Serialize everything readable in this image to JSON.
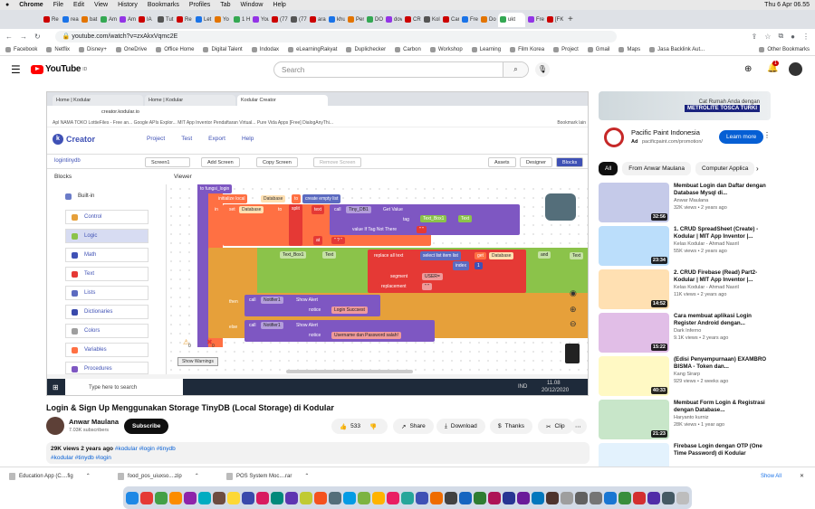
{
  "menubar": {
    "app": "Chrome",
    "items": [
      "File",
      "Edit",
      "View",
      "History",
      "Bookmarks",
      "Profiles",
      "Tab",
      "Window",
      "Help"
    ],
    "clock": "Thu 6 Apr 06.55"
  },
  "tabs": [
    "Re",
    "rea",
    "bat",
    "Am",
    "Am",
    "IA",
    "Tut",
    "Re",
    "Let",
    "Yo",
    "1 Hi",
    "You",
    "(77",
    "(77",
    "ara",
    "khu",
    "Per",
    "DO",
    "dov",
    "CR",
    "Kol",
    "Car",
    "Fre",
    "Do",
    "ukt",
    "Fre",
    "[FK"
  ],
  "address": {
    "url": "youtube.com/watch?v=zxAkxVqmc2E"
  },
  "bookmarks": [
    "Facebook",
    "Netflix",
    "Disney+",
    "OneDrive",
    "Office Home",
    "Digital Talent",
    "Indodax",
    "eLearningRakyat",
    "Duplichecker",
    "Carbon",
    "Workshop",
    "Learning",
    "Film Korea",
    "Project",
    "Gmail",
    "Maps",
    "Jasa Backlink Aut...",
    "Other Bookmarks"
  ],
  "youtube": {
    "logo": "YouTube",
    "region": "ID",
    "search_placeholder": "Search",
    "notif_count": "1"
  },
  "video": {
    "inner_tabs": [
      "Home | Kodular",
      "Home | Kodular",
      "Kodular Creator"
    ],
    "inner_url": "creator.kodular.io",
    "inner_bookmarks": "Apl  NAMA TOKO  LottieFiles - Free an...  Google APIs Explor...  MIT App Inventor  Pendaftaran Virtual...  Pure Vida Apps  [Free] DialogAnyThi...",
    "inner_bookmarks_right": "Bookmark lain",
    "kodular_logo": "Creator",
    "kodular_menu": [
      "Project",
      "Test",
      "Export",
      "Help"
    ],
    "screen_name": "logintinydb",
    "toolbar": {
      "screen": "Screen1",
      "add": "Add Screen",
      "copy": "Copy Screen",
      "remove": "Remove Screen",
      "assets": "Assets",
      "designer": "Designer",
      "blocks": "Blocks"
    },
    "pane_heads": {
      "blocks": "Blocks",
      "viewer": "Viewer"
    },
    "palette": [
      "Built-in",
      "Control",
      "Logic",
      "Math",
      "Text",
      "Lists",
      "Dictionaries",
      "Colors",
      "Variables",
      "Procedures"
    ],
    "blocks": {
      "proc": "to fungsi_login",
      "init": "initialize local",
      "init_var": "Database",
      "to": "to",
      "create": "create empty list",
      "in": "in",
      "set": "set",
      "set_var": "Database",
      "split": "split",
      "text": "text",
      "call": "call",
      "tinydb": "Tiny_DB1",
      "getvalue": "Get Value",
      "tag": "tag",
      "tb1": "Text_Box1",
      "tb1_text": "Text",
      "iftag": "value If Tag Not There",
      "at": "at",
      "tb1b": "Text_Box1",
      "tb1b_text": "Text",
      "replace": "replace all text",
      "select": "select list item  list",
      "get": "get",
      "get_var": "Database",
      "index": "index",
      "num": "1",
      "segment": "segment",
      "userq": "USER=",
      "replacement": "replacement",
      "and": "and",
      "text_r": "Text",
      "then": "then",
      "notif": "Notifier1",
      "show": "Show Alert",
      "notice": "notice",
      "msg1": "Login Succsest",
      "else": "else",
      "notif2": "Notifier1",
      "show2": "Show Alert",
      "notice2": "notice",
      "msg2": "Username dan Password salah!",
      "warn0": "0",
      "warn1": "0",
      "show_warnings": "Show Warnings"
    },
    "taskbar": {
      "search": "Type here to search",
      "lang": "IND",
      "time": "11.08",
      "date": "20/12/2020"
    }
  },
  "title": "Login & Sign Up Menggunakan Storage TinyDB (Local Storage) di Kodular",
  "channel": {
    "name": "Anwar Maulana",
    "subs": "7.03K subscribers",
    "subscribe": "Subscribe"
  },
  "actions": {
    "likes": "533",
    "share": "Share",
    "download": "Download",
    "thanks": "Thanks",
    "clip": "Clip"
  },
  "description": {
    "stats": "29K views  2 years ago",
    "tags": "#kodular #login #tinydb",
    "tags2": "#kodular #tinydb #login"
  },
  "ad": {
    "banner_top": "Cat Rumah Anda dengan",
    "banner_main": "METROLITE TOSCA TURKI",
    "title": "Pacific Paint Indonesia",
    "tag": "Ad",
    "url": "pacificpaint.com/promotion/",
    "cta": "Learn more"
  },
  "chips": [
    "All",
    "From Anwar Maulana",
    "Computer Applica"
  ],
  "recs": [
    {
      "title": "Membuat Login dan Daftar dengan Database Mysql di...",
      "channel": "Anwar Maulana",
      "meta": "32K views • 2 years ago",
      "dur": "32:56"
    },
    {
      "title": "1. CRUD SpreadSheet (Create) - Kodular | MIT App Inventor |...",
      "channel": "Kelas Kodular - Ahmad Nasril",
      "meta": "55K views • 2 years ago",
      "dur": "23:34"
    },
    {
      "title": "2. CRUD Firebase (Read) Part2- Kodular | MIT App Inventor |...",
      "channel": "Kelas Kodular - Ahmad Nasril",
      "meta": "11K views • 2 years ago",
      "dur": "14:52"
    },
    {
      "title": "Cara membuat aplikasi Login Register Android dengan...",
      "channel": "Dark Inferno",
      "meta": "9.1K views • 2 years ago",
      "dur": "15:22"
    },
    {
      "title": "(Edisi Penyempurnaan) EXAMBRO BISMA - Token dan...",
      "channel": "Kang Sirarp",
      "meta": "929 views • 2 weeks ago",
      "dur": "40:33"
    },
    {
      "title": "Membuat Form Login & Registrasi dengan Database...",
      "channel": "Haryanto kurniz",
      "meta": "28K views • 1 year ago",
      "dur": "21:23"
    },
    {
      "title": "Firebase Login dengan OTP (One Time Password) di Kodular",
      "channel": "",
      "meta": "",
      "dur": ""
    }
  ],
  "downloads": [
    "Education App (C....fig",
    "food_pos_uiuxso....zip",
    "POS System Moc....rar"
  ],
  "downloads_showall": "Show All"
}
